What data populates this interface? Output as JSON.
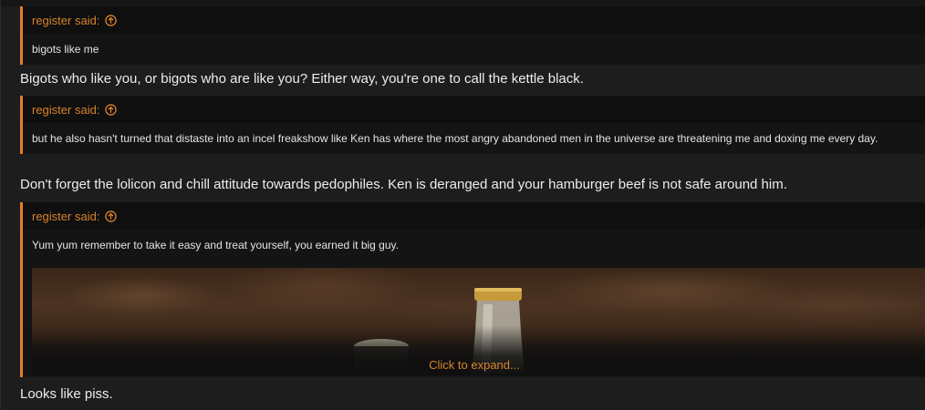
{
  "quotes": [
    {
      "author_label": "register said:",
      "body": "bigots like me"
    },
    {
      "author_label": "register said:",
      "body": "but he also hasn't turned that distaste into an incel freakshow like Ken has where the most angry abandoned men in the universe are threatening me and doxing me every day."
    },
    {
      "author_label": "register said:",
      "body": "Yum yum remember to take it easy and treat yourself, you earned it big guy.",
      "expand_label": "Click to expand..."
    }
  ],
  "replies": [
    "Bigots who like you, or bigots who are like you? Either way, you're one to call the kettle black.",
    "Don't forget the lolicon and chill attitude towards pedophiles. Ken is deranged and your hamburger beef is not safe around him.",
    "Looks like piss."
  ],
  "colors": {
    "accent": "#e67e22",
    "quote_author": "#d9822b",
    "background": "#1d1d1d"
  },
  "icons": {
    "quote_jump": "arrow-up-circle-icon"
  }
}
